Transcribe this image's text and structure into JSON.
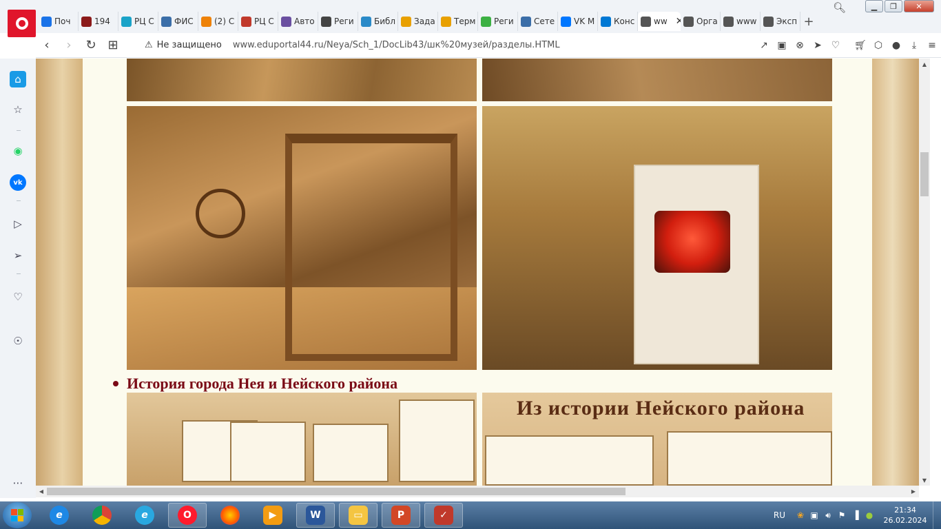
{
  "browser": {
    "tabs": [
      {
        "label": "Поч",
        "icon": "mail-icon",
        "color": "#1a73e8"
      },
      {
        "label": "194",
        "icon": "museum-icon",
        "color": "#8b1a1a"
      },
      {
        "label": "РЦ С",
        "icon": "ok44-icon",
        "color": "#1aa3c8"
      },
      {
        "label": "ФИС",
        "icon": "fis-icon",
        "color": "#3b6ea8"
      },
      {
        "label": "(2) С",
        "icon": "odnoklassniki-icon",
        "color": "#ee8208"
      },
      {
        "label": "РЦ С",
        "icon": "rc-icon",
        "color": "#c0392b"
      },
      {
        "label": "Авто",
        "icon": "auto-icon",
        "color": "#6a4fa0"
      },
      {
        "label": "Реги",
        "icon": "grid-icon",
        "color": "#444444"
      },
      {
        "label": "Библ",
        "icon": "library-icon",
        "color": "#2a8ac8"
      },
      {
        "label": "Зада",
        "icon": "task-icon",
        "color": "#e8a000"
      },
      {
        "label": "Терм",
        "icon": "term-icon",
        "color": "#e8a000"
      },
      {
        "label": "Реги",
        "icon": "puzzle-icon",
        "color": "#3cb043"
      },
      {
        "label": "Сете",
        "icon": "network-icon",
        "color": "#3b6ea8"
      },
      {
        "label": "VK М",
        "icon": "vk-icon",
        "color": "#0077ff"
      },
      {
        "label": "Конс",
        "icon": "skype-icon",
        "color": "#0078d4"
      },
      {
        "label": "ww",
        "icon": "globe-icon",
        "color": "#555555",
        "active": true
      },
      {
        "label": "Орга",
        "icon": "globe-icon",
        "color": "#555555"
      },
      {
        "label": "www",
        "icon": "globe-icon",
        "color": "#555555"
      },
      {
        "label": "Эксп",
        "icon": "apps-icon",
        "color": "#555555"
      }
    ],
    "security_label": "Не защищено",
    "url": "www.eduportal44.ru/Neya/Sch_1/DocLib43/шк%20музей/разделы.HTML"
  },
  "page": {
    "section_heading": "История города Нея и Нейского района",
    "sign_text": "Из истории Нейского района"
  },
  "taskbar": {
    "language": "RU",
    "time": "21:34",
    "date": "26.02.2024"
  }
}
